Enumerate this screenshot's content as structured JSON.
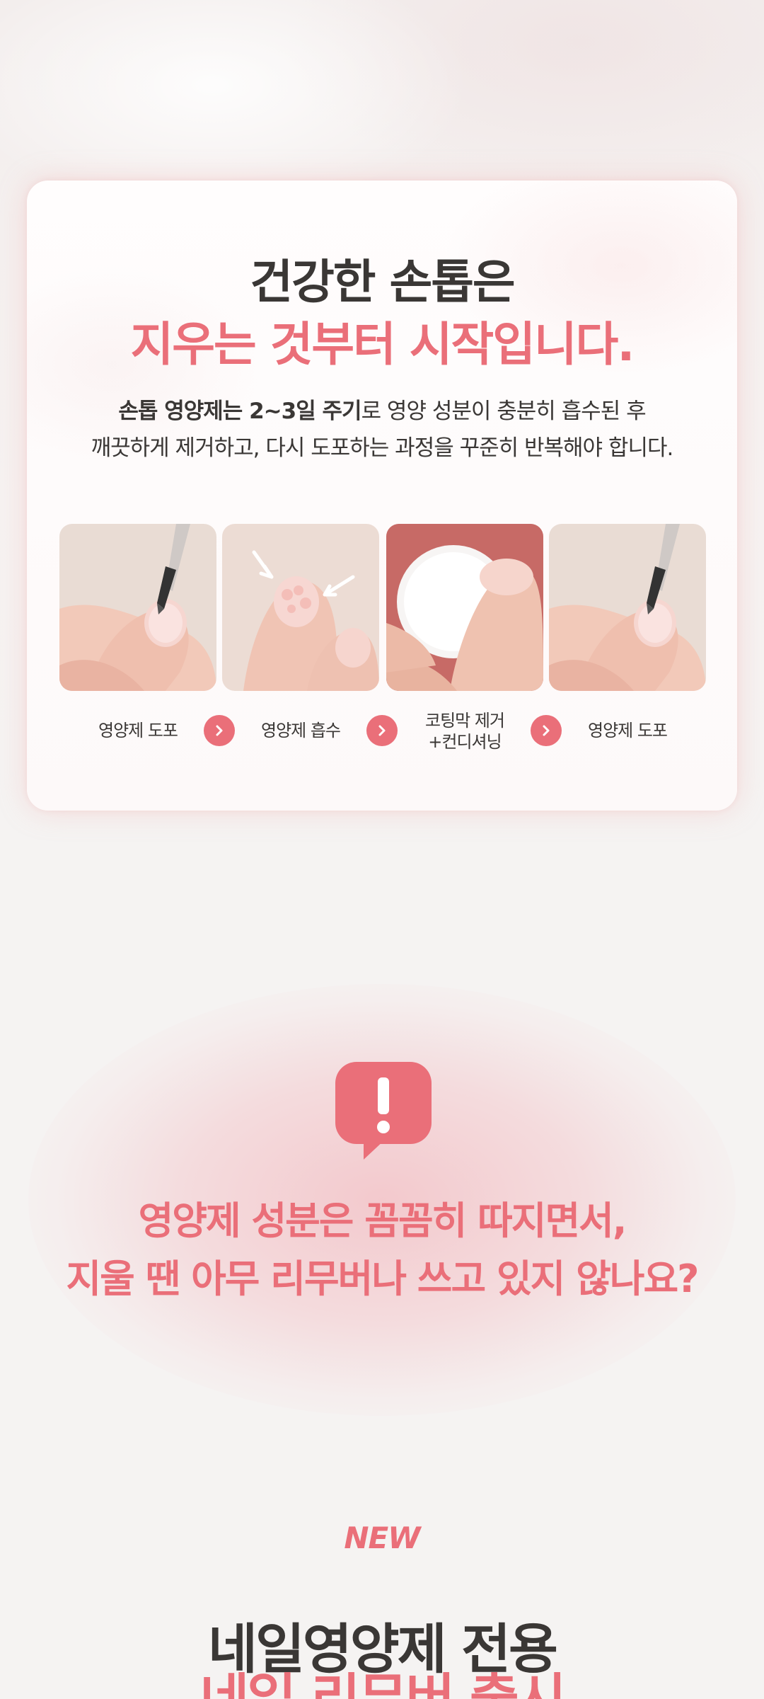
{
  "card": {
    "title_line1": "건강한 손톱은",
    "title_line2": "지우는 것부터 시작입니다.",
    "desc_line1_bold_a": "손톱 영양제는 2~3일 주기",
    "desc_line1_rest": "로 영양 성분이 충분히 흡수된 후",
    "desc_line2": "깨끗하게 제거하고, 다시 도포하는 과정을 꾸준히 반복해야 합니다.",
    "steps": [
      {
        "label": "영양제 도포"
      },
      {
        "label": "영양제 흡수"
      },
      {
        "label_l1": "코팅막 제거",
        "label_l2": "+컨디셔닝"
      },
      {
        "label": "영양제 도포"
      }
    ]
  },
  "alert": {
    "icon": "exclamation-speech-bubble-icon",
    "line1": "영양제 성분은 꼼꼼히 따지면서,",
    "line2": "지울 땐 아무 리무버나 쓰고 있지 않나요?"
  },
  "promo": {
    "badge": "NEW",
    "title_line1": "네일영양제 전용",
    "title_line2": "네일 리무버 출시"
  },
  "colors": {
    "accent": "#ea6f79",
    "text": "#3a3735",
    "background": "#f5f3f2"
  }
}
